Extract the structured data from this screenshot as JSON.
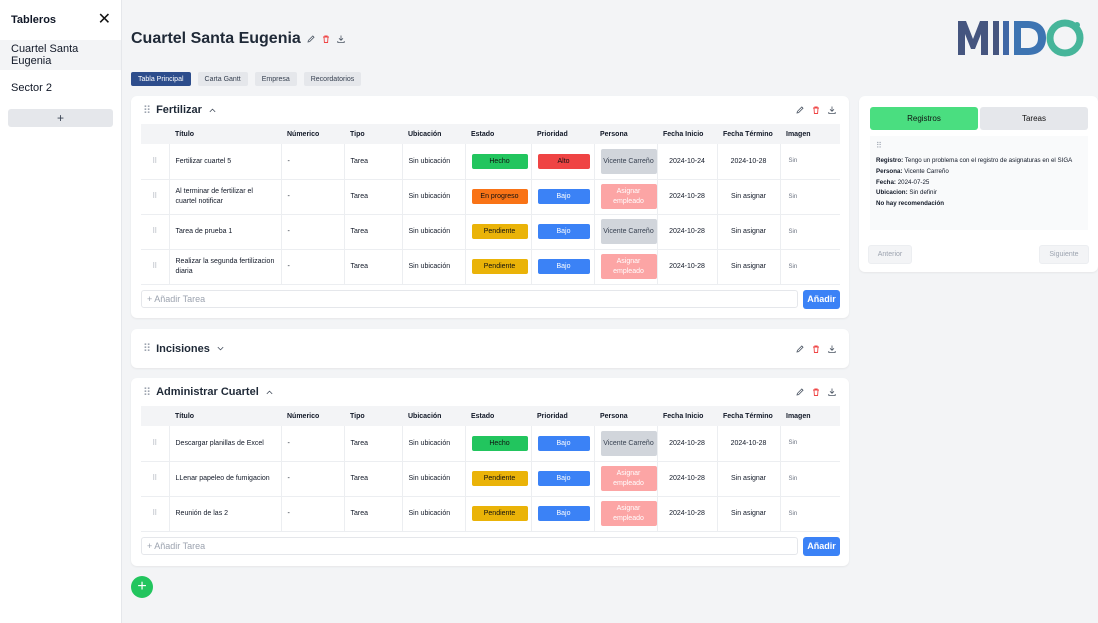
{
  "sidebar": {
    "title": "Tableros",
    "close_label": "✕",
    "items": [
      {
        "label": "Cuartel Santa Eugenia"
      },
      {
        "label": "Sector 2"
      }
    ],
    "add_label": "+"
  },
  "header": {
    "title": "Cuartel Santa Eugenia",
    "logo_text": "MIIDO"
  },
  "tabs": [
    "Tabla Principal",
    "Carta Gantt",
    "Empresa",
    "Recordatorios"
  ],
  "columns": [
    "Título",
    "Númerico",
    "Tipo",
    "Ubicación",
    "Estado",
    "Prioridad",
    "Persona",
    "Fecha Inicio",
    "Fecha Término",
    "Imagen"
  ],
  "add_task_placeholder": "+ Añadir Tarea",
  "add_button_label": "Añadir",
  "image_alt": "Sin",
  "boards": [
    {
      "title": "Fertilizar",
      "rows": [
        {
          "titulo": "Fertilizar cuartel 5",
          "numerico": "-",
          "tipo": "Tarea",
          "ubicacion": "Sin ubicación",
          "estado": "Hecho",
          "prioridad": "Alto",
          "persona": "Vicente Carreño",
          "inicio": "2024-10-24",
          "termino": "2024-10-28"
        },
        {
          "titulo": "Al terminar de fertilizar el cuartel notificar",
          "numerico": "-",
          "tipo": "Tarea",
          "ubicacion": "Sin ubicación",
          "estado": "En progreso",
          "prioridad": "Bajo",
          "persona": "Asignar empleado",
          "inicio": "2024-10-28",
          "termino": "Sin asignar"
        },
        {
          "titulo": "Tarea de prueba 1",
          "numerico": "-",
          "tipo": "Tarea",
          "ubicacion": "Sin ubicación",
          "estado": "Pendiente",
          "prioridad": "Bajo",
          "persona": "Vicente Carreño",
          "inicio": "2024-10-28",
          "termino": "Sin asignar"
        },
        {
          "titulo": "Realizar la segunda fertilizacion diaria",
          "numerico": "-",
          "tipo": "Tarea",
          "ubicacion": "Sin ubicación",
          "estado": "Pendiente",
          "prioridad": "Bajo",
          "persona": "Asignar empleado",
          "inicio": "2024-10-28",
          "termino": "Sin asignar"
        }
      ]
    },
    {
      "title": "Incisiones",
      "rows": []
    },
    {
      "title": "Administrar Cuartel",
      "rows": [
        {
          "titulo": "Descargar planillas de Excel",
          "numerico": "-",
          "tipo": "Tarea",
          "ubicacion": "Sin ubicación",
          "estado": "Hecho",
          "prioridad": "Bajo",
          "persona": "Vicente Carreño",
          "inicio": "2024-10-28",
          "termino": "2024-10-28"
        },
        {
          "titulo": "LLenar papeleo de fumigacion",
          "numerico": "-",
          "tipo": "Tarea",
          "ubicacion": "Sin ubicación",
          "estado": "Pendiente",
          "prioridad": "Bajo",
          "persona": "Asignar empleado",
          "inicio": "2024-10-28",
          "termino": "Sin asignar"
        },
        {
          "titulo": "Reunión de las 2",
          "numerico": "-",
          "tipo": "Tarea",
          "ubicacion": "Sin ubicación",
          "estado": "Pendiente",
          "prioridad": "Bajo",
          "persona": "Asignar empleado",
          "inicio": "2024-10-28",
          "termino": "Sin asignar"
        }
      ]
    }
  ],
  "colors": {
    "Hecho": "#22c55e",
    "En progreso": "#f97316",
    "Pendiente": "#eab308",
    "Alto": "#ef4444",
    "Bajo": "#3b82f6"
  },
  "panel": {
    "tab_registros": "Registros",
    "tab_tareas": "Tareas",
    "registro_label": "Registro:",
    "registro_text": "Tengo un problema con el registro de asignaturas en el SIGA",
    "persona_label": "Persona:",
    "persona_text": "Vicente Carreño",
    "fecha_label": "Fecha:",
    "fecha_text": "2024-07-25",
    "ubicacion_label": "Ubicacion:",
    "ubicacion_text": "Sin definir",
    "recomendacion": "No hay recomendación",
    "prev_label": "Anterior",
    "next_label": "Siguiente"
  },
  "fab_label": "+"
}
